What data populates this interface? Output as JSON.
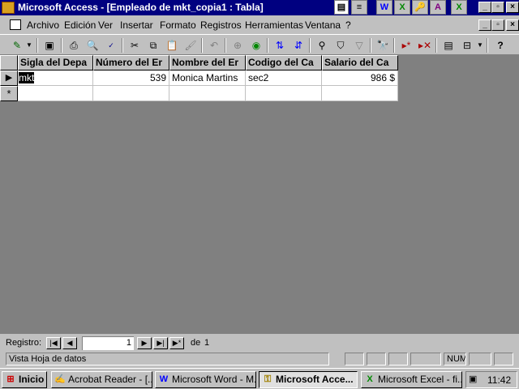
{
  "window": {
    "title": "Microsoft Access - [Empleado de mkt_copia1 : Tabla]"
  },
  "title_toolbar": [
    "W",
    "X",
    "🔑",
    "A",
    "X"
  ],
  "menu": [
    "Archivo",
    "Edición",
    "Ver",
    "Insertar",
    "Formato",
    "Registros",
    "Herramientas",
    "Ventana",
    "?"
  ],
  "table": {
    "columns": [
      "Sigla del Depa",
      "Número del Er",
      "Nombre del Er",
      "Codigo del Ca",
      "Salario del Ca"
    ],
    "rows": [
      [
        "mkt",
        "539",
        "Monica Martins",
        "sec2",
        "986 $"
      ]
    ],
    "new_row_marker": "*",
    "current_row_marker": "▶"
  },
  "navigation": {
    "label": "Registro:",
    "current": "1",
    "of_label": "de",
    "total": "1"
  },
  "status": {
    "text": "Vista Hoja de datos",
    "num": "NUM"
  },
  "taskbar": {
    "start": "Inicio",
    "tasks": [
      "Acrobat Reader - [...",
      "Microsoft Word - M...",
      "Microsoft Acce...",
      "Microsoft Excel - fi..."
    ],
    "clock": "11:42"
  }
}
